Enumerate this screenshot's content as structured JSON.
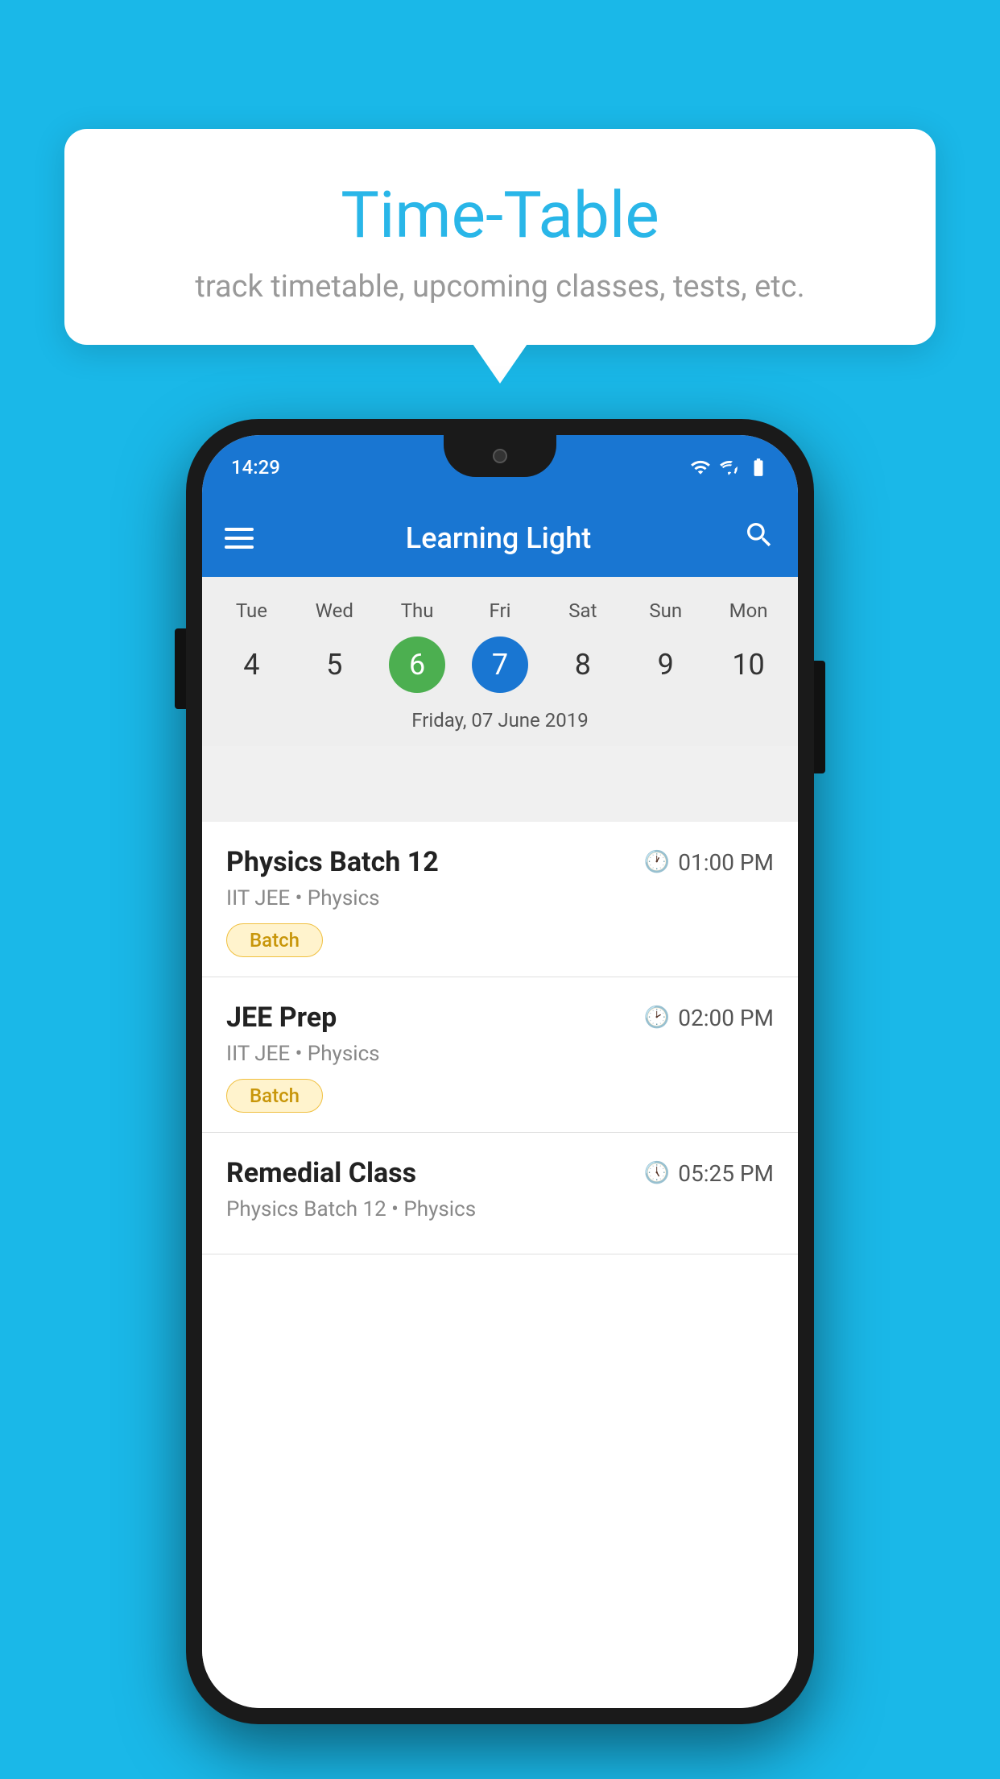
{
  "background_color": "#1ab8e8",
  "tooltip": {
    "title": "Time-Table",
    "subtitle": "track timetable, upcoming classes, tests, etc."
  },
  "phone": {
    "status_time": "14:29",
    "app_title": "Learning Light",
    "menu_label": "Menu",
    "search_label": "Search",
    "calendar": {
      "days": [
        "Tue",
        "Wed",
        "Thu",
        "Fri",
        "Sat",
        "Sun",
        "Mon"
      ],
      "dates": [
        "4",
        "5",
        "6",
        "7",
        "8",
        "9",
        "10"
      ],
      "today_index": 2,
      "selected_index": 3,
      "selected_date_label": "Friday, 07 June 2019"
    },
    "schedule": [
      {
        "title": "Physics Batch 12",
        "time": "01:00 PM",
        "subtitle": "IIT JEE • Physics",
        "badge": "Batch"
      },
      {
        "title": "JEE Prep",
        "time": "02:00 PM",
        "subtitle": "IIT JEE • Physics",
        "badge": "Batch"
      },
      {
        "title": "Remedial Class",
        "time": "05:25 PM",
        "subtitle": "Physics Batch 12 • Physics",
        "badge": ""
      }
    ]
  }
}
